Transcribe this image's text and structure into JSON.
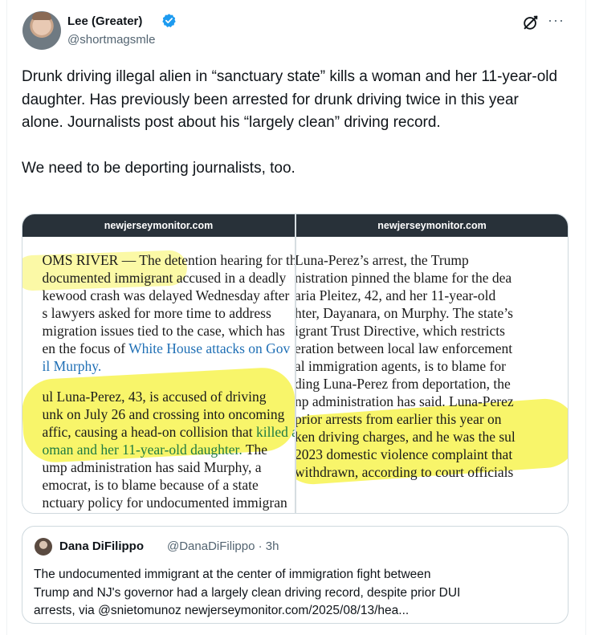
{
  "tweet": {
    "author_name": "Lee (Greater)",
    "author_handle": "@shortmagsmle",
    "verified_icon": "verified-badge-icon",
    "paragraphs": [
      "Drunk driving illegal alien in “sanctuary state” kills a woman and her 11-year-old daughter. Has previously been arrested for drunk driving twice in this year alone. Journalists post about his “largely clean” driving record.",
      "We need to be deporting journalists, too."
    ],
    "more_label": "···"
  },
  "media": {
    "left": {
      "site": "newjerseymonitor.com",
      "lines": [
        "OMS RIVER — The detention hearing for th­",
        "documented immigrant accused in a deadly",
        "kewood crash was delayed Wednesday after",
        "s lawyers asked for more time to address",
        "migration issues tied to the case, which has",
        "en the focus of ",
        "il Murphy.",
        "ul Luna-Perez, 43, is accused of driving",
        "unk on July 26 and crossing into oncoming",
        "affic, causing a head-on collision that ",
        "oman and her 11-year-old daughter.",
        " The",
        "ump administration has said Murphy, a",
        "emocrat, is to blame because of a state",
        "nctuary policy for undocumented immigran"
      ],
      "link_text": "White House attacks on Gov",
      "killed_text": "killed a"
    },
    "right": {
      "site": "newjerseymonitor.com",
      "lines": [
        " Luna-Perez’s arrest, the Trump",
        "nistration pinned the blame for the dea",
        "aria Pleitez, 42, and her 11-year-old",
        "hter, Dayanara, on Murphy. The state’s",
        "igrant Trust Directive, which restricts",
        "eration between local law enforcement",
        "al immigration agents, is to blame for",
        "ding Luna-Perez from deportation, the",
        "np administration has said.",
        " Luna-Perez",
        "prior arrests from earlier this year on",
        "ken driving charges",
        ", and he was the sul",
        "2023 domestic violence complaint that",
        "withdrawn, according to court officials"
      ]
    }
  },
  "quote": {
    "name": "Dana DiFilippo",
    "handle_time": "@DanaDiFilippo · 3h",
    "lines": [
      "The undocumented immigrant at the center of immigration fight between",
      "Trump and NJ's governor had a largely clean driving record, despite prior DUI",
      "arrests, via @snietomunoz newjerseymonitor.com/2025/08/13/hea..."
    ]
  },
  "colors": {
    "verified": "#1d9bf0",
    "highlight": "#f7f35a",
    "site_bar": "#283139",
    "secondary_text": "#536471"
  }
}
